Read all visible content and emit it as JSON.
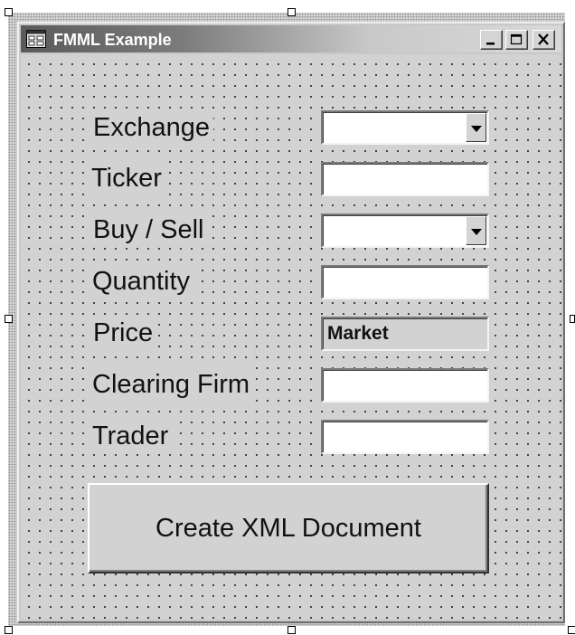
{
  "window": {
    "title": "FMML Example",
    "caption_buttons": {
      "minimize": "minimize-icon",
      "maximize": "maximize-icon",
      "close": "close-icon"
    }
  },
  "form": {
    "fields": [
      {
        "label": "Exchange",
        "type": "dropdown",
        "value": ""
      },
      {
        "label": "Ticker",
        "type": "text",
        "value": ""
      },
      {
        "label": "Buy / Sell",
        "type": "dropdown",
        "value": ""
      },
      {
        "label": "Quantity",
        "type": "text",
        "value": ""
      },
      {
        "label": "Price",
        "type": "readonly",
        "value": "Market"
      },
      {
        "label": "Clearing Firm",
        "type": "text",
        "value": ""
      },
      {
        "label": "Trader",
        "type": "text",
        "value": ""
      }
    ],
    "submit_label": "Create XML Document"
  },
  "colors": {
    "form_background": "#d2d2d2",
    "title_gradient_start": "#5a5a5a",
    "title_gradient_end": "#d9d9d9",
    "title_text": "#ffffff"
  }
}
